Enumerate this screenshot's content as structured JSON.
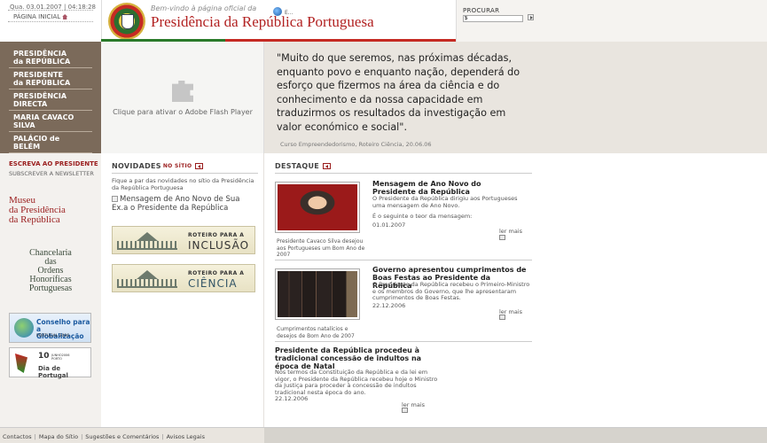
{
  "header": {
    "datetime": "Qua. 03.01.2007 | 04:18:28",
    "home_label": "PÁGINA INICIAL",
    "welcome": "Bem-vindo à página oficial da",
    "site_title": "Presidência da República Portuguesa",
    "search_label": "PROCURAR",
    "search_value": "$"
  },
  "nav": {
    "items": [
      {
        "line1": "PRESIDÊNCIA",
        "line2": "da REPÚBLICA"
      },
      {
        "line1": "PRESIDENTE",
        "line2": "da REPÚBLICA"
      },
      {
        "line1": "PRESIDÊNCIA",
        "line2": "DIRECTA"
      },
      {
        "line1": "MARIA CAVACO SILVA",
        "line2": ""
      },
      {
        "line1": "PALÁCIO de BELÉM",
        "line2": ""
      }
    ]
  },
  "sidebar": {
    "write": "ESCREVA AO PRESIDENTE",
    "subscribe": "SUBSCREVER A NEWSLETTER",
    "museu": [
      "Museu",
      "da Presidência",
      "da",
      "República"
    ],
    "chancelaria": [
      "Chancelaria",
      "das",
      "Ordens",
      "Honoríficas",
      "Portuguesas"
    ],
    "globalizacao": {
      "line1": "Conselho para",
      "line2": "a Globalização",
      "sub": "PORTUGAL 2006"
    },
    "dia_portugal": {
      "num": "10",
      "small1": "JUNHO2006",
      "small2": "PORTO",
      "title": "Dia de Portugal"
    }
  },
  "flash": {
    "text": "Clique para ativar o Adobe Flash Player"
  },
  "quote": {
    "text": "\"Muito do que seremos, nas próximas décadas, enquanto povo e enquanto nação, dependerá do esforço que fizermos na área da ciência e do conhecimento e da nossa capacidade em traduzirmos os resultados da investigação em valor económico e social\".",
    "source": "Curso Empreendedorismo, Roteiro Ciência, 20.06.06"
  },
  "novidades": {
    "title": "NOVIDADES",
    "title_accent": "NO SÍTIO",
    "intro": "Fique a par das novidades no sítio da Presidência da República Portuguesa",
    "img_alt": "Mensagem de Ano Novo de Sua Ex.a o Presidente da República",
    "roteiros": [
      {
        "small": "ROTEIRO PARA A",
        "big": "INCLUSÃO"
      },
      {
        "small": "ROTEIRO PARA A",
        "big": "CIÊNCIA"
      }
    ]
  },
  "destaque": {
    "title": "DESTAQUE",
    "items": [
      {
        "caption": "Presidente Cavaco Silva desejou aos Portugueses um Bom Ano de 2007",
        "title": "Mensagem de Ano Novo do Presidente da República",
        "body": "O Presidente da República dirigiu aos Portugueses uma mensagem de Ano Novo.",
        "body2": "É o seguinte o teor da mensagem:",
        "date": "01.01.2007",
        "more": "ler mais"
      },
      {
        "caption": "Cumprimentos natalícios e desejos de Bom Ano de 2007",
        "title": "Governo apresentou cumprimentos de Boas Festas ao Presidente da República",
        "body": "O Presidente da República recebeu o Primeiro-Ministro e os membros do Governo, que lhe apresentaram cumprimentos de Boas Festas.",
        "body2": "",
        "date": "22.12.2006",
        "more": "ler mais"
      },
      {
        "caption": "",
        "title": "Presidente da República procedeu à tradicional concessão de indultos na época de Natal",
        "body": "Nos termos da Constituição da República e da lei em vigor, o Presidente da República recebeu hoje o Ministro da Justiça para proceder à concessão de indultos tradicional nesta época do ano.",
        "body2": "",
        "date": "22.12.2006",
        "more": "ler mais"
      }
    ]
  },
  "footer": {
    "links": [
      "Contactos",
      "Mapa do Sítio",
      "Sugestões e Comentários",
      "Avisos Legais"
    ],
    "globe_text": "E..."
  },
  "colors": {
    "brand_red": "#b22222",
    "nav_brown": "#7b6a5a",
    "quote_bg": "#e9e5df"
  }
}
